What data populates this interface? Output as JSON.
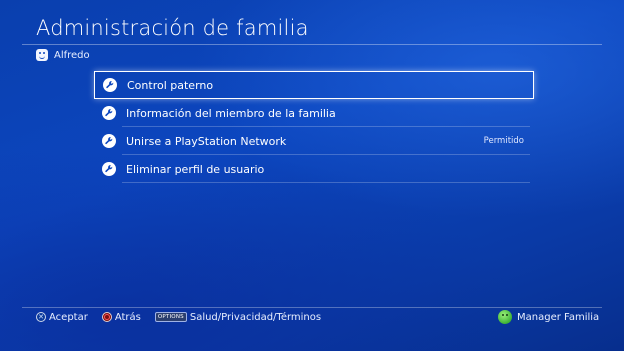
{
  "header": {
    "title": "Administración de familia"
  },
  "user": {
    "name": "Alfredo"
  },
  "menu": {
    "items": [
      {
        "label": "Control paterno",
        "value": "",
        "icon": "wrench-icon"
      },
      {
        "label": "Información del miembro de la familia",
        "value": "",
        "icon": "wrench-icon"
      },
      {
        "label": "Unirse a PlayStation Network",
        "value": "Permitido",
        "icon": "wrench-icon"
      },
      {
        "label": "Eliminar perfil de usuario",
        "value": "",
        "icon": "wrench-icon"
      }
    ],
    "selected_index": 0
  },
  "footer": {
    "accept_label": "Aceptar",
    "back_label": "Atrás",
    "options_button": "OPTIONS",
    "options_label": "Salud/Privacidad/Términos",
    "manager_label": "Manager Familia"
  },
  "colors": {
    "background": "#0c46bf",
    "selection_border": "#ffffff"
  }
}
